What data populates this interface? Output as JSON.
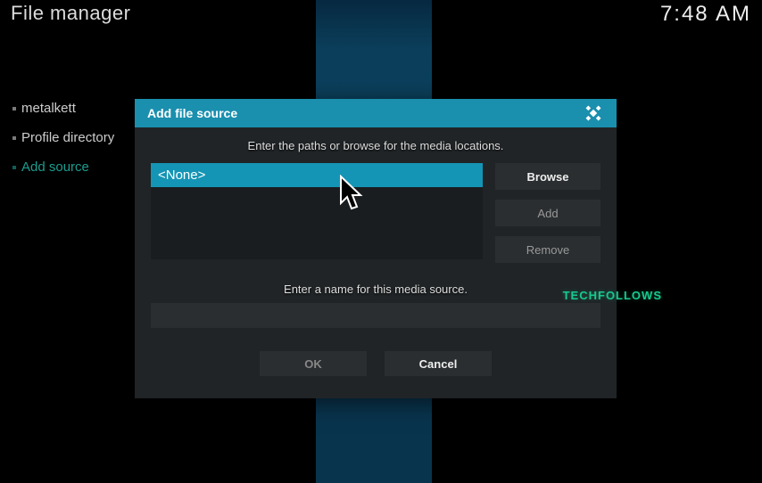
{
  "header": {
    "title": "File manager",
    "clock": "7:48 AM"
  },
  "sidebar": {
    "items": [
      {
        "label": "metalkett",
        "active": false
      },
      {
        "label": "Profile directory",
        "active": false
      },
      {
        "label": "Add source",
        "active": true
      }
    ]
  },
  "modal": {
    "title": "Add file source",
    "paths_instruction": "Enter the paths or browse for the media locations.",
    "path_entries": [
      "<None>"
    ],
    "browse_label": "Browse",
    "add_label": "Add",
    "remove_label": "Remove",
    "name_instruction": "Enter a name for this media source.",
    "name_value": "",
    "ok_label": "OK",
    "cancel_label": "Cancel"
  },
  "watermark": "TECHFOLLOWS"
}
